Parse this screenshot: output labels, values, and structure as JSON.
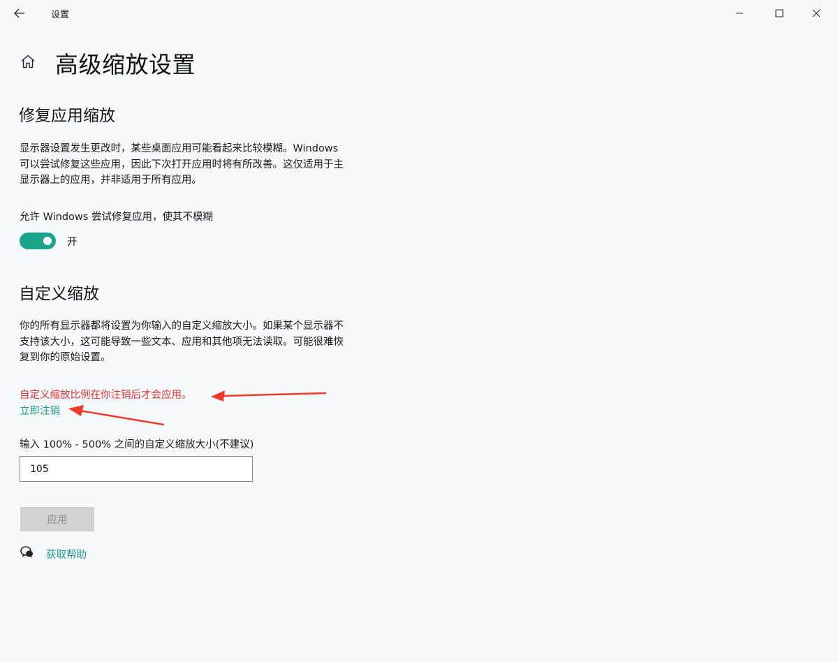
{
  "window": {
    "title": "设置"
  },
  "header": {
    "title": "高级缩放设置"
  },
  "fix_scaling": {
    "title": "修复应用缩放",
    "description_lines": [
      "显示器设置发生更改时，某些桌面应用可能看起来比较模糊。Windows",
      "可以尝试修复这些应用，因此下次打开应用时将有所改善。这仅适用于主",
      "显示器上的应用，并非适用于所有应用。"
    ],
    "toggle_label": "允许 Windows 尝试修复应用，使其不模糊",
    "toggle_state": "开",
    "toggle_on": true
  },
  "custom_scaling": {
    "title": "自定义缩放",
    "description_lines": [
      "你的所有显示器都将设置为你输入的自定义缩放大小。如果某个显示器不",
      "支持该大小，这可能导致一些文本、应用和其他项无法读取。可能很难恢",
      "复到你的原始设置。"
    ],
    "warning": "自定义缩放比例在你注销后才会应用。",
    "signout_link": "立即注销",
    "input_label": "输入 100% - 500% 之间的自定义缩放大小(不建议)",
    "input_value": "105",
    "apply_label": "应用"
  },
  "help": {
    "label": "获取帮助"
  },
  "colors": {
    "accent": "#1aa58a",
    "link": "#1b9a86",
    "warning": "#e0322e",
    "annotation_arrow": "#ee3a2c"
  }
}
